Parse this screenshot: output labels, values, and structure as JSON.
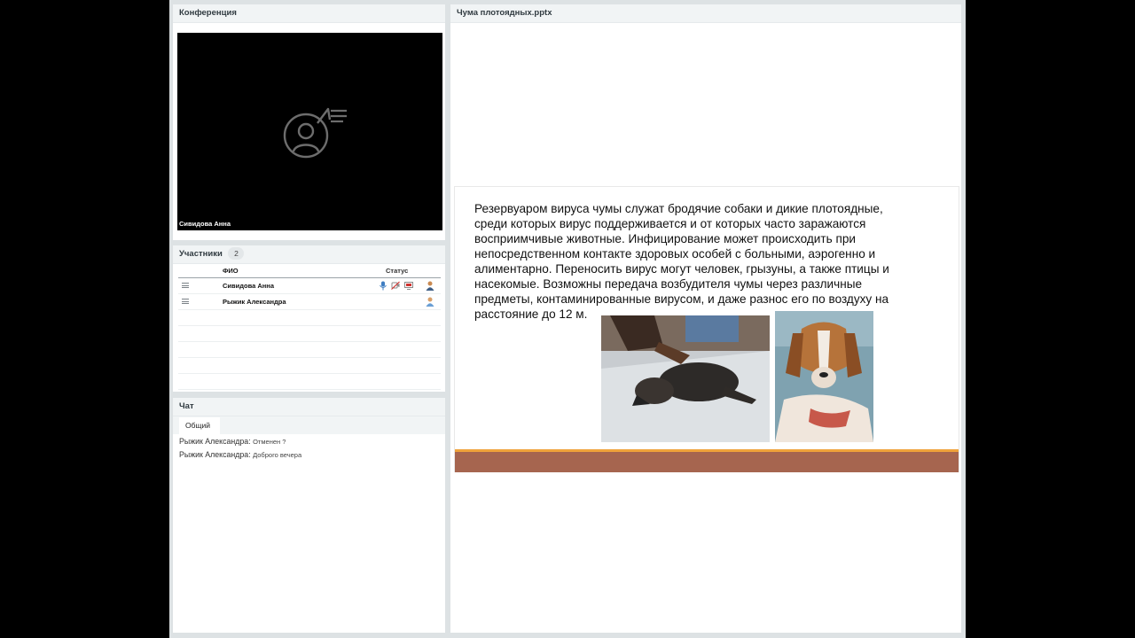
{
  "conference": {
    "title": "Конференция",
    "video_caption": "Сивидова Анна",
    "placeholder_icon": "user-chat-icon"
  },
  "participants": {
    "title": "Участники",
    "count": "2",
    "col_name": "ФИО",
    "col_status": "Статус",
    "rows": [
      {
        "name": "Сивидова Анна",
        "icons": [
          "microphone-icon",
          "camera-off-icon",
          "screen-share-icon",
          "presenter-avatar-icon"
        ]
      },
      {
        "name": "Рыжик Александра",
        "icons": [
          "participant-avatar-icon"
        ]
      }
    ]
  },
  "chat": {
    "title": "Чат",
    "tab": "Общий",
    "messages": [
      {
        "author": "Рыжик Александра:",
        "text": "Отменен ?"
      },
      {
        "author": "Рыжик Александра:",
        "text": "Доброго вечера"
      }
    ]
  },
  "presentation": {
    "title": "Чума плотоядных.pptx",
    "slide_text": "Резервуаром вируса чумы служат бродячие собаки и дикие плотоядные, среди которых вирус поддерживается и от которых часто заражаются восприимчивые животные. Инфицирование может происходить при непосредственном контакте здоровых особей с больными, аэрогенно и алиментарно. Переносить вирус могут человек, грызуны, а также птицы и насекомые. Возможны передача возбудителя чумы через различные предметы, контаминированные вирусом, и даже разнос его по воздуху на расстояние до 12 м.",
    "accent_color": "#a6654f",
    "stripe_color": "#f0a23a"
  }
}
